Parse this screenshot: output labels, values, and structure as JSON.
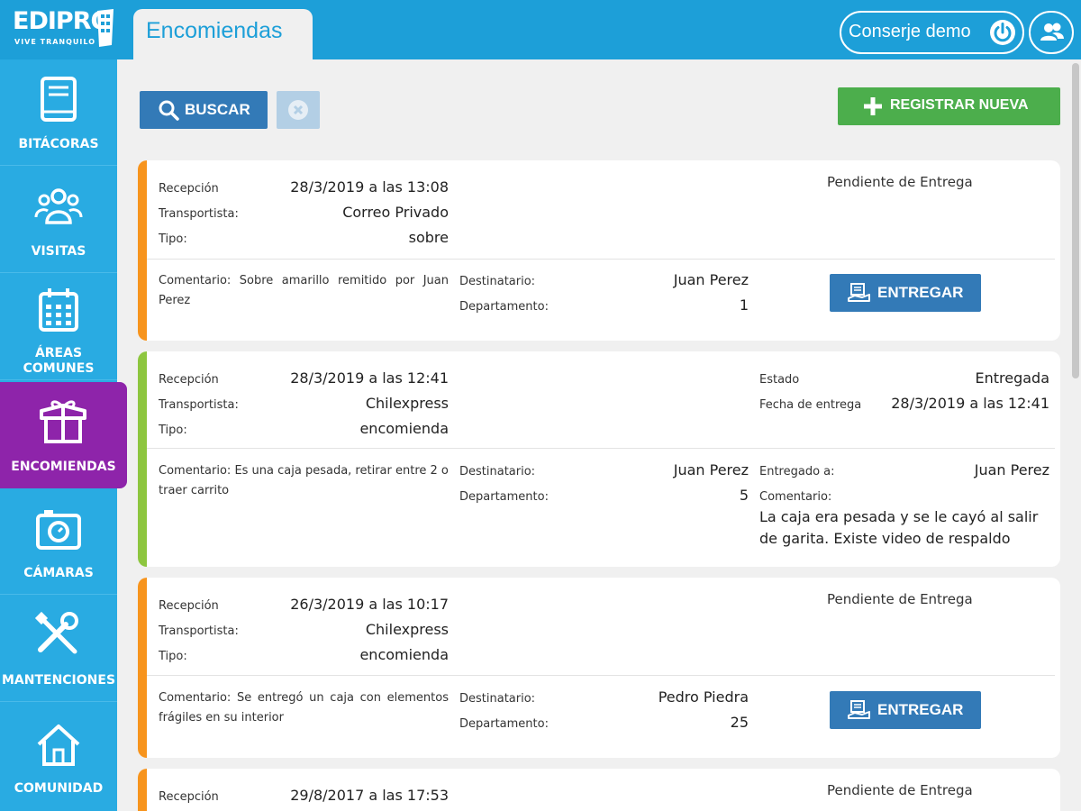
{
  "app": {
    "logo_text": "EDIPRO",
    "logo_tagline": "VIVE TRANQUILO",
    "active_tab": "Encomiendas",
    "user_name": "Conserje demo"
  },
  "sidebar": {
    "items": [
      {
        "label": "BITÁCORAS",
        "icon": "book-icon"
      },
      {
        "label": "VISITAS",
        "icon": "people-icon"
      },
      {
        "label": "ÁREAS COMUNES",
        "icon": "calendar-icon"
      },
      {
        "label": "ENCOMIENDAS",
        "icon": "package-icon",
        "active": true
      },
      {
        "label": "CÁMARAS",
        "icon": "camera-icon"
      },
      {
        "label": "MANTENCIONES",
        "icon": "tools-icon"
      },
      {
        "label": "COMUNIDAD",
        "icon": "home-icon"
      }
    ]
  },
  "toolbar": {
    "search_label": "BUSCAR",
    "new_label": "REGISTRAR NUEVA"
  },
  "labels": {
    "reception": "Recepción",
    "carrier": "Transportista:",
    "type": "Tipo:",
    "comment_prefix": "Comentario:",
    "recipient": "Destinatario:",
    "department": "Departamento:",
    "state": "Estado",
    "delivery_date": "Fecha de entrega",
    "delivered_to": "Entregado a:",
    "comment": "Comentario:",
    "deliver_button": "ENTREGAR"
  },
  "colors": {
    "pending": "#f7941d",
    "delivered": "#8dc63f",
    "active_nav": "#8e24aa",
    "primary": "#337ab7",
    "success": "#4cae4c"
  },
  "packages": [
    {
      "status": "Pendiente de Entrega",
      "reception": "28/3/2019 a las 13:08",
      "carrier": "Correo Privado",
      "type": "sobre",
      "comment": "Sobre amarillo remitido por Juan Perez",
      "recipient": "Juan Perez",
      "department": "1"
    },
    {
      "status": "Entregada",
      "reception": "28/3/2019 a las 12:41",
      "carrier": "Chilexpress",
      "type": "encomienda",
      "comment": "Es una caja pesada, retirar entre 2 o traer carrito",
      "recipient": "Juan Perez",
      "department": "5",
      "delivery_date": "28/3/2019 a las 12:41",
      "delivered_to": "Juan Perez",
      "delivery_comment": "La caja era pesada y se le cayó al salir de garita. Existe video de respaldo"
    },
    {
      "status": "Pendiente de Entrega",
      "reception": "26/3/2019 a las 10:17",
      "carrier": "Chilexpress",
      "type": "encomienda",
      "comment": "Se entregó un caja con elementos frágiles en su interior",
      "recipient": "Pedro Piedra",
      "department": "25"
    },
    {
      "status": "Pendiente de Entrega",
      "reception": "29/8/2017 a las 17:53"
    }
  ]
}
